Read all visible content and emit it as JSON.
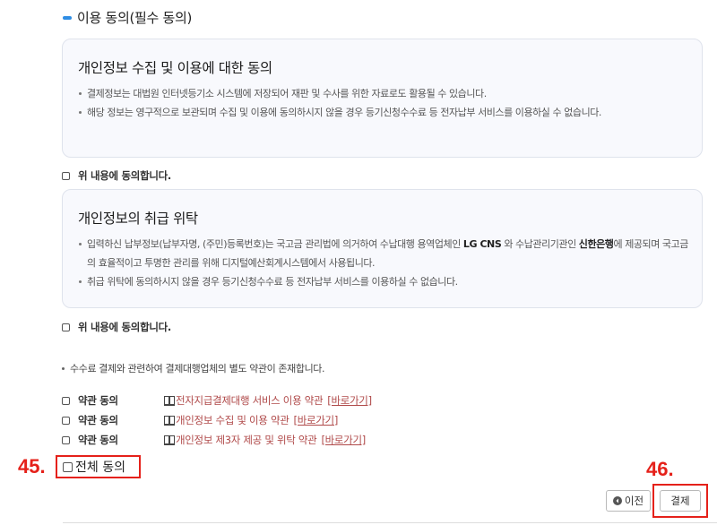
{
  "section": {
    "title": "이용 동의(필수 동의)"
  },
  "consent1": {
    "title": "개인정보 수집 및 이용에 대한 동의",
    "bullets": [
      "결제정보는 대법원 인터넷등기소 시스템에 저장되어 재판 및 수사를 위한 자료로도 활용될 수 있습니다.",
      "해당 정보는 영구적으로 보관되며 수집 및 이용에 동의하시지 않을 경우 등기신청수수료 등 전자납부 서비스를 이용하실 수 없습니다."
    ],
    "agree_label": "위 내용에 동의합니다."
  },
  "consent2": {
    "title": "개인정보의 취급 위탁",
    "bullet1": {
      "a": "입력하신 납부정보(납부자명, (주민)등록번호)는 국고금 관리법에 의거하여 수납대행 용역업체인 ",
      "b": "LG CNS",
      "c": " 와 수납관리기관인 ",
      "d": "신한은행",
      "e": "에 제공되며 국고금의 효율적이고 투명한 관리를 위해 디지털예산회계시스템에서 사용됩니다."
    },
    "bullet2": "취급 위탁에 동의하시지 않을 경우 등기신청수수료 등 전자납부 서비스를 이용하실 수 없습니다.",
    "agree_label": "위 내용에 동의합니다."
  },
  "note": "수수료 결제와 관련하여 결제대행업체의 별도 약관이 존재합니다.",
  "terms": [
    {
      "label": "약관 동의",
      "name": "전자지급결제대행 서비스 이용 약관",
      "link": "[바로가기]"
    },
    {
      "label": "약관 동의",
      "name": "개인정보 수집 및 이용 약관",
      "link": "[바로가기]"
    },
    {
      "label": "약관 동의",
      "name": "개인정보 제3자 제공 및 위탁 약관",
      "link": "[바로가기]"
    }
  ],
  "all_agree_label": "전체 동의",
  "annotations": {
    "a45": "45.",
    "a46": "46."
  },
  "buttons": {
    "prev": "이전",
    "pay": "결제"
  },
  "colors": {
    "accent": "#2f8de4",
    "annotation": "#e5211a",
    "link": "#b04a4a"
  }
}
